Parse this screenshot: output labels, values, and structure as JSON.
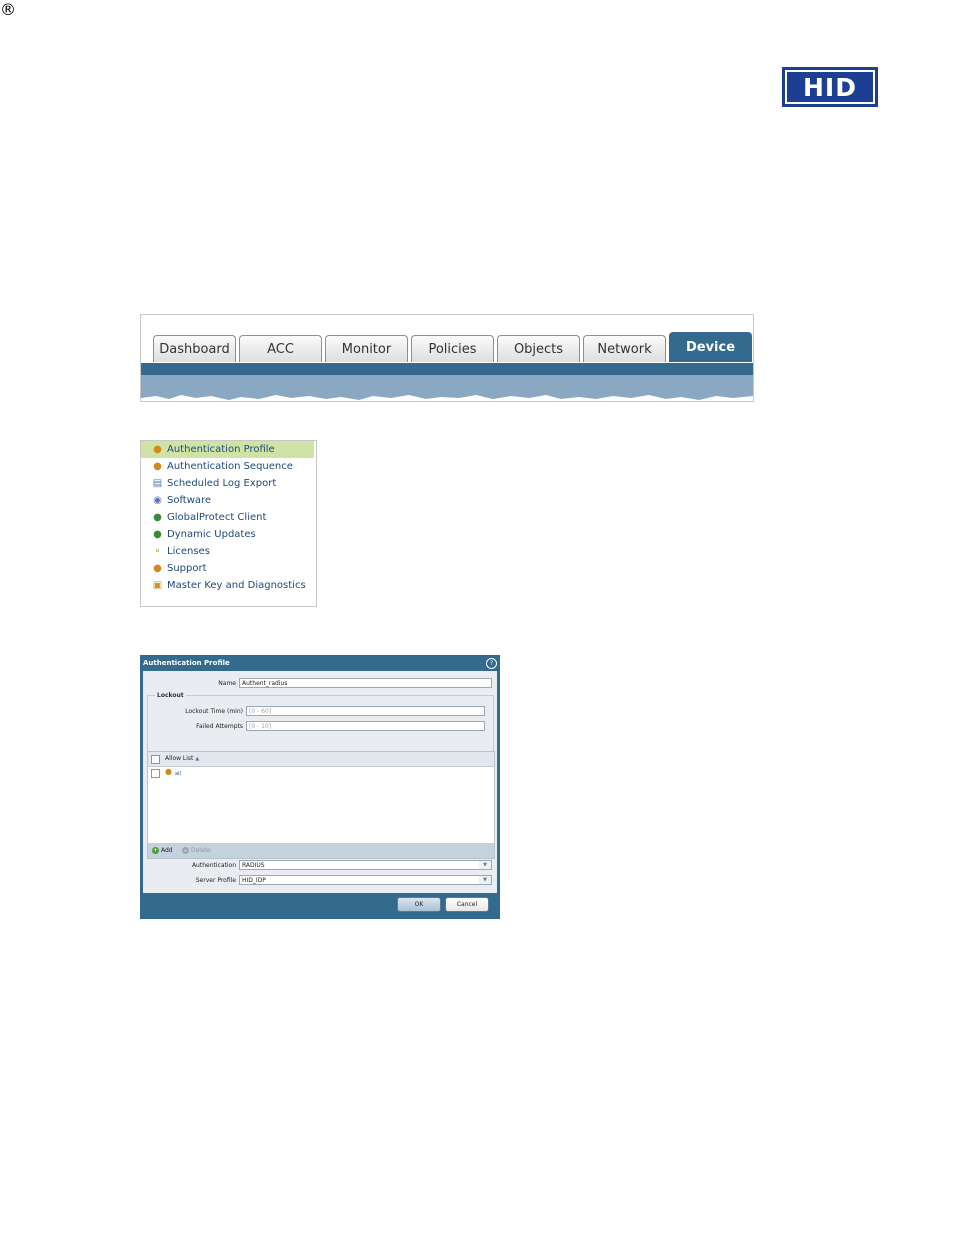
{
  "logo": {
    "text": "HID",
    "mark": "®",
    "color": "#1c3f94"
  },
  "tabs": [
    {
      "label": "Dashboard",
      "active": false
    },
    {
      "label": "ACC",
      "active": false
    },
    {
      "label": "Monitor",
      "active": false
    },
    {
      "label": "Policies",
      "active": false
    },
    {
      "label": "Objects",
      "active": false
    },
    {
      "label": "Network",
      "active": false
    },
    {
      "label": "Device",
      "active": true
    }
  ],
  "device_menu": [
    {
      "label": "Authentication Profile",
      "icon": "users-icon",
      "selected": true
    },
    {
      "label": "Authentication Sequence",
      "icon": "users-sequence-icon",
      "selected": false
    },
    {
      "label": "Scheduled Log Export",
      "icon": "document-icon",
      "selected": false
    },
    {
      "label": "Software",
      "icon": "disc-icon",
      "selected": false
    },
    {
      "label": "GlobalProtect Client",
      "icon": "globe-icon",
      "selected": false
    },
    {
      "label": "Dynamic Updates",
      "icon": "globe-update-icon",
      "selected": false
    },
    {
      "label": "Licenses",
      "icon": "key-icon",
      "selected": false
    },
    {
      "label": "Support",
      "icon": "support-icon",
      "selected": false
    },
    {
      "label": "Master Key and Diagnostics",
      "icon": "lock-icon",
      "selected": false
    }
  ],
  "dialog": {
    "title": "Authentication Profile",
    "help_icon": "?",
    "name_label": "Name",
    "name_value": "Authent_radius",
    "lockout_legend": "Lockout",
    "lockout_time_label": "Lockout Time (min)",
    "lockout_time_placeholder": "[0 - 60]",
    "failed_attempts_label": "Failed Attempts",
    "failed_attempts_placeholder": "[0 - 10]",
    "allow_list_header": "Allow List",
    "sort_indicator": "▲",
    "allow_list_items": [
      {
        "label": "all"
      }
    ],
    "add_label": "Add",
    "delete_label": "Delete",
    "authentication_label": "Authentication",
    "authentication_value": "RADIUS",
    "server_profile_label": "Server Profile",
    "server_profile_value": "HID_IDP",
    "ok_label": "OK",
    "cancel_label": "Cancel"
  },
  "colors": {
    "accent": "#336a8e",
    "selected_row": "#cfe3a6",
    "link_text": "#214a7a"
  }
}
